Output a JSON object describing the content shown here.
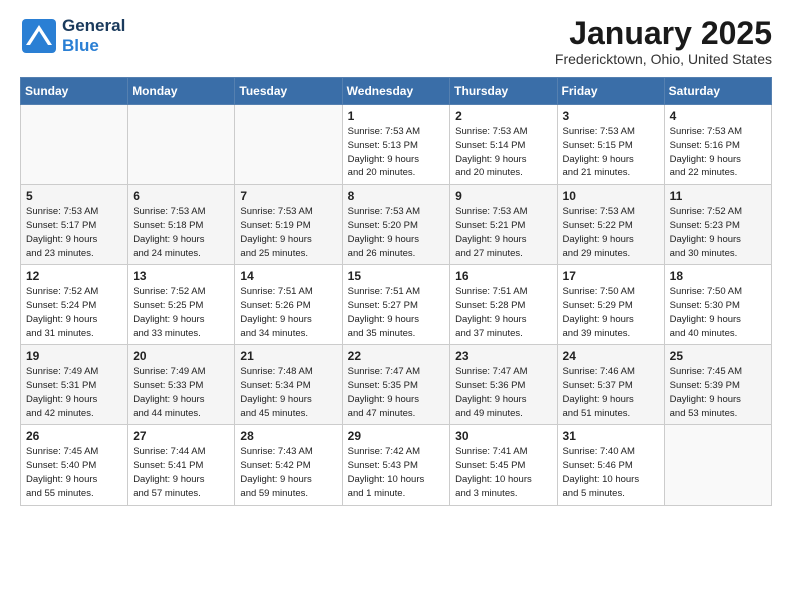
{
  "header": {
    "logo_general": "General",
    "logo_blue": "Blue",
    "month_title": "January 2025",
    "location": "Fredericktown, Ohio, United States"
  },
  "days_of_week": [
    "Sunday",
    "Monday",
    "Tuesday",
    "Wednesday",
    "Thursday",
    "Friday",
    "Saturday"
  ],
  "weeks": [
    [
      {
        "day": "",
        "info": ""
      },
      {
        "day": "",
        "info": ""
      },
      {
        "day": "",
        "info": ""
      },
      {
        "day": "1",
        "info": "Sunrise: 7:53 AM\nSunset: 5:13 PM\nDaylight: 9 hours\nand 20 minutes."
      },
      {
        "day": "2",
        "info": "Sunrise: 7:53 AM\nSunset: 5:14 PM\nDaylight: 9 hours\nand 20 minutes."
      },
      {
        "day": "3",
        "info": "Sunrise: 7:53 AM\nSunset: 5:15 PM\nDaylight: 9 hours\nand 21 minutes."
      },
      {
        "day": "4",
        "info": "Sunrise: 7:53 AM\nSunset: 5:16 PM\nDaylight: 9 hours\nand 22 minutes."
      }
    ],
    [
      {
        "day": "5",
        "info": "Sunrise: 7:53 AM\nSunset: 5:17 PM\nDaylight: 9 hours\nand 23 minutes."
      },
      {
        "day": "6",
        "info": "Sunrise: 7:53 AM\nSunset: 5:18 PM\nDaylight: 9 hours\nand 24 minutes."
      },
      {
        "day": "7",
        "info": "Sunrise: 7:53 AM\nSunset: 5:19 PM\nDaylight: 9 hours\nand 25 minutes."
      },
      {
        "day": "8",
        "info": "Sunrise: 7:53 AM\nSunset: 5:20 PM\nDaylight: 9 hours\nand 26 minutes."
      },
      {
        "day": "9",
        "info": "Sunrise: 7:53 AM\nSunset: 5:21 PM\nDaylight: 9 hours\nand 27 minutes."
      },
      {
        "day": "10",
        "info": "Sunrise: 7:53 AM\nSunset: 5:22 PM\nDaylight: 9 hours\nand 29 minutes."
      },
      {
        "day": "11",
        "info": "Sunrise: 7:52 AM\nSunset: 5:23 PM\nDaylight: 9 hours\nand 30 minutes."
      }
    ],
    [
      {
        "day": "12",
        "info": "Sunrise: 7:52 AM\nSunset: 5:24 PM\nDaylight: 9 hours\nand 31 minutes."
      },
      {
        "day": "13",
        "info": "Sunrise: 7:52 AM\nSunset: 5:25 PM\nDaylight: 9 hours\nand 33 minutes."
      },
      {
        "day": "14",
        "info": "Sunrise: 7:51 AM\nSunset: 5:26 PM\nDaylight: 9 hours\nand 34 minutes."
      },
      {
        "day": "15",
        "info": "Sunrise: 7:51 AM\nSunset: 5:27 PM\nDaylight: 9 hours\nand 35 minutes."
      },
      {
        "day": "16",
        "info": "Sunrise: 7:51 AM\nSunset: 5:28 PM\nDaylight: 9 hours\nand 37 minutes."
      },
      {
        "day": "17",
        "info": "Sunrise: 7:50 AM\nSunset: 5:29 PM\nDaylight: 9 hours\nand 39 minutes."
      },
      {
        "day": "18",
        "info": "Sunrise: 7:50 AM\nSunset: 5:30 PM\nDaylight: 9 hours\nand 40 minutes."
      }
    ],
    [
      {
        "day": "19",
        "info": "Sunrise: 7:49 AM\nSunset: 5:31 PM\nDaylight: 9 hours\nand 42 minutes."
      },
      {
        "day": "20",
        "info": "Sunrise: 7:49 AM\nSunset: 5:33 PM\nDaylight: 9 hours\nand 44 minutes."
      },
      {
        "day": "21",
        "info": "Sunrise: 7:48 AM\nSunset: 5:34 PM\nDaylight: 9 hours\nand 45 minutes."
      },
      {
        "day": "22",
        "info": "Sunrise: 7:47 AM\nSunset: 5:35 PM\nDaylight: 9 hours\nand 47 minutes."
      },
      {
        "day": "23",
        "info": "Sunrise: 7:47 AM\nSunset: 5:36 PM\nDaylight: 9 hours\nand 49 minutes."
      },
      {
        "day": "24",
        "info": "Sunrise: 7:46 AM\nSunset: 5:37 PM\nDaylight: 9 hours\nand 51 minutes."
      },
      {
        "day": "25",
        "info": "Sunrise: 7:45 AM\nSunset: 5:39 PM\nDaylight: 9 hours\nand 53 minutes."
      }
    ],
    [
      {
        "day": "26",
        "info": "Sunrise: 7:45 AM\nSunset: 5:40 PM\nDaylight: 9 hours\nand 55 minutes."
      },
      {
        "day": "27",
        "info": "Sunrise: 7:44 AM\nSunset: 5:41 PM\nDaylight: 9 hours\nand 57 minutes."
      },
      {
        "day": "28",
        "info": "Sunrise: 7:43 AM\nSunset: 5:42 PM\nDaylight: 9 hours\nand 59 minutes."
      },
      {
        "day": "29",
        "info": "Sunrise: 7:42 AM\nSunset: 5:43 PM\nDaylight: 10 hours\nand 1 minute."
      },
      {
        "day": "30",
        "info": "Sunrise: 7:41 AM\nSunset: 5:45 PM\nDaylight: 10 hours\nand 3 minutes."
      },
      {
        "day": "31",
        "info": "Sunrise: 7:40 AM\nSunset: 5:46 PM\nDaylight: 10 hours\nand 5 minutes."
      },
      {
        "day": "",
        "info": ""
      }
    ]
  ]
}
